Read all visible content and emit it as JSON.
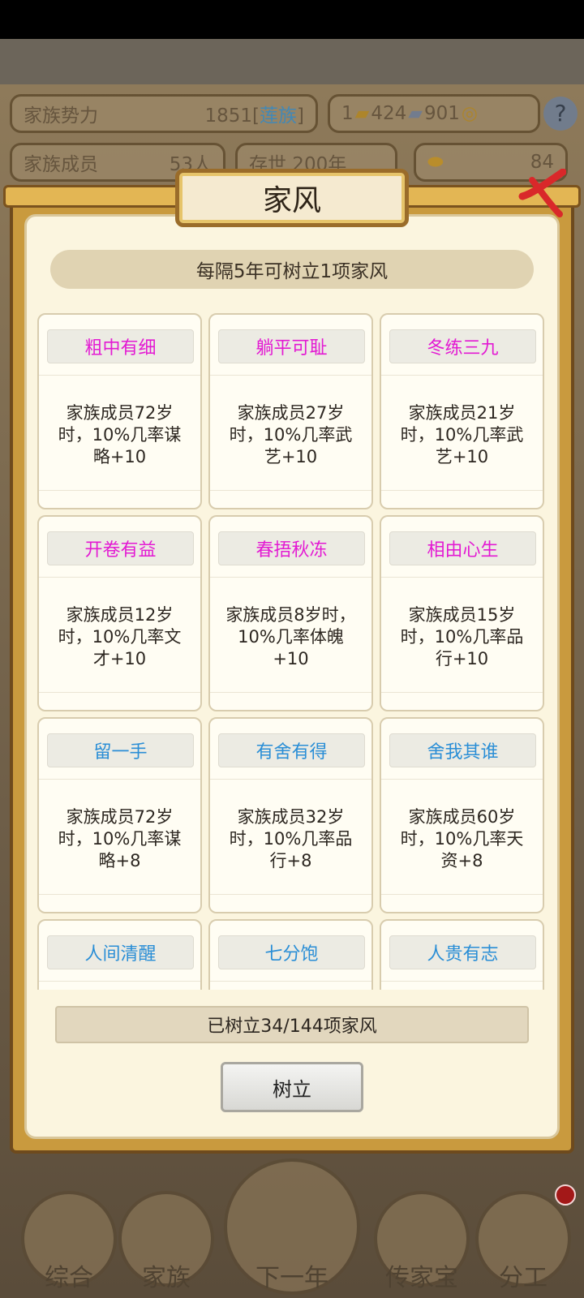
{
  "background": {
    "stats": {
      "family_power_label": "家族势力",
      "family_power_value": "1851[",
      "family_power_rank": "莲族",
      "family_power_end": "]",
      "family_members_label": "家族成员",
      "family_members_value": "53人",
      "existence": "存世 200年",
      "res1": "1",
      "res2": "424",
      "res3": "901",
      "gold": "84"
    },
    "nav": [
      "综合",
      "家族",
      "下一年",
      "传家宝",
      "分工"
    ]
  },
  "modal": {
    "title": "家风",
    "info": "每隔5年可树立1项家风",
    "cards": [
      {
        "name": "粗中有细",
        "desc": "家族成员72岁时，10%几率谋略+10",
        "color": "pink"
      },
      {
        "name": "躺平可耻",
        "desc": "家族成员27岁时，10%几率武艺+10",
        "color": "pink"
      },
      {
        "name": "冬练三九",
        "desc": "家族成员21岁时，10%几率武艺+10",
        "color": "pink"
      },
      {
        "name": "开卷有益",
        "desc": "家族成员12岁时，10%几率文才+10",
        "color": "pink"
      },
      {
        "name": "春捂秋冻",
        "desc": "家族成员8岁时，10%几率体魄+10",
        "color": "pink"
      },
      {
        "name": "相由心生",
        "desc": "家族成员15岁时，10%几率品行+10",
        "color": "pink"
      },
      {
        "name": "留一手",
        "desc": "家族成员72岁时，10%几率谋略+8",
        "color": "blue"
      },
      {
        "name": "有舍有得",
        "desc": "家族成员32岁时，10%几率品行+8",
        "color": "blue"
      },
      {
        "name": "舍我其谁",
        "desc": "家族成员60岁时，10%几率天资+8",
        "color": "blue"
      },
      {
        "name": "人间清醒",
        "desc": "",
        "color": "blue"
      },
      {
        "name": "七分饱",
        "desc": "",
        "color": "blue"
      },
      {
        "name": "人贵有志",
        "desc": "",
        "color": "blue"
      }
    ],
    "progress": "已树立34/144项家风",
    "confirm_label": "树立"
  }
}
